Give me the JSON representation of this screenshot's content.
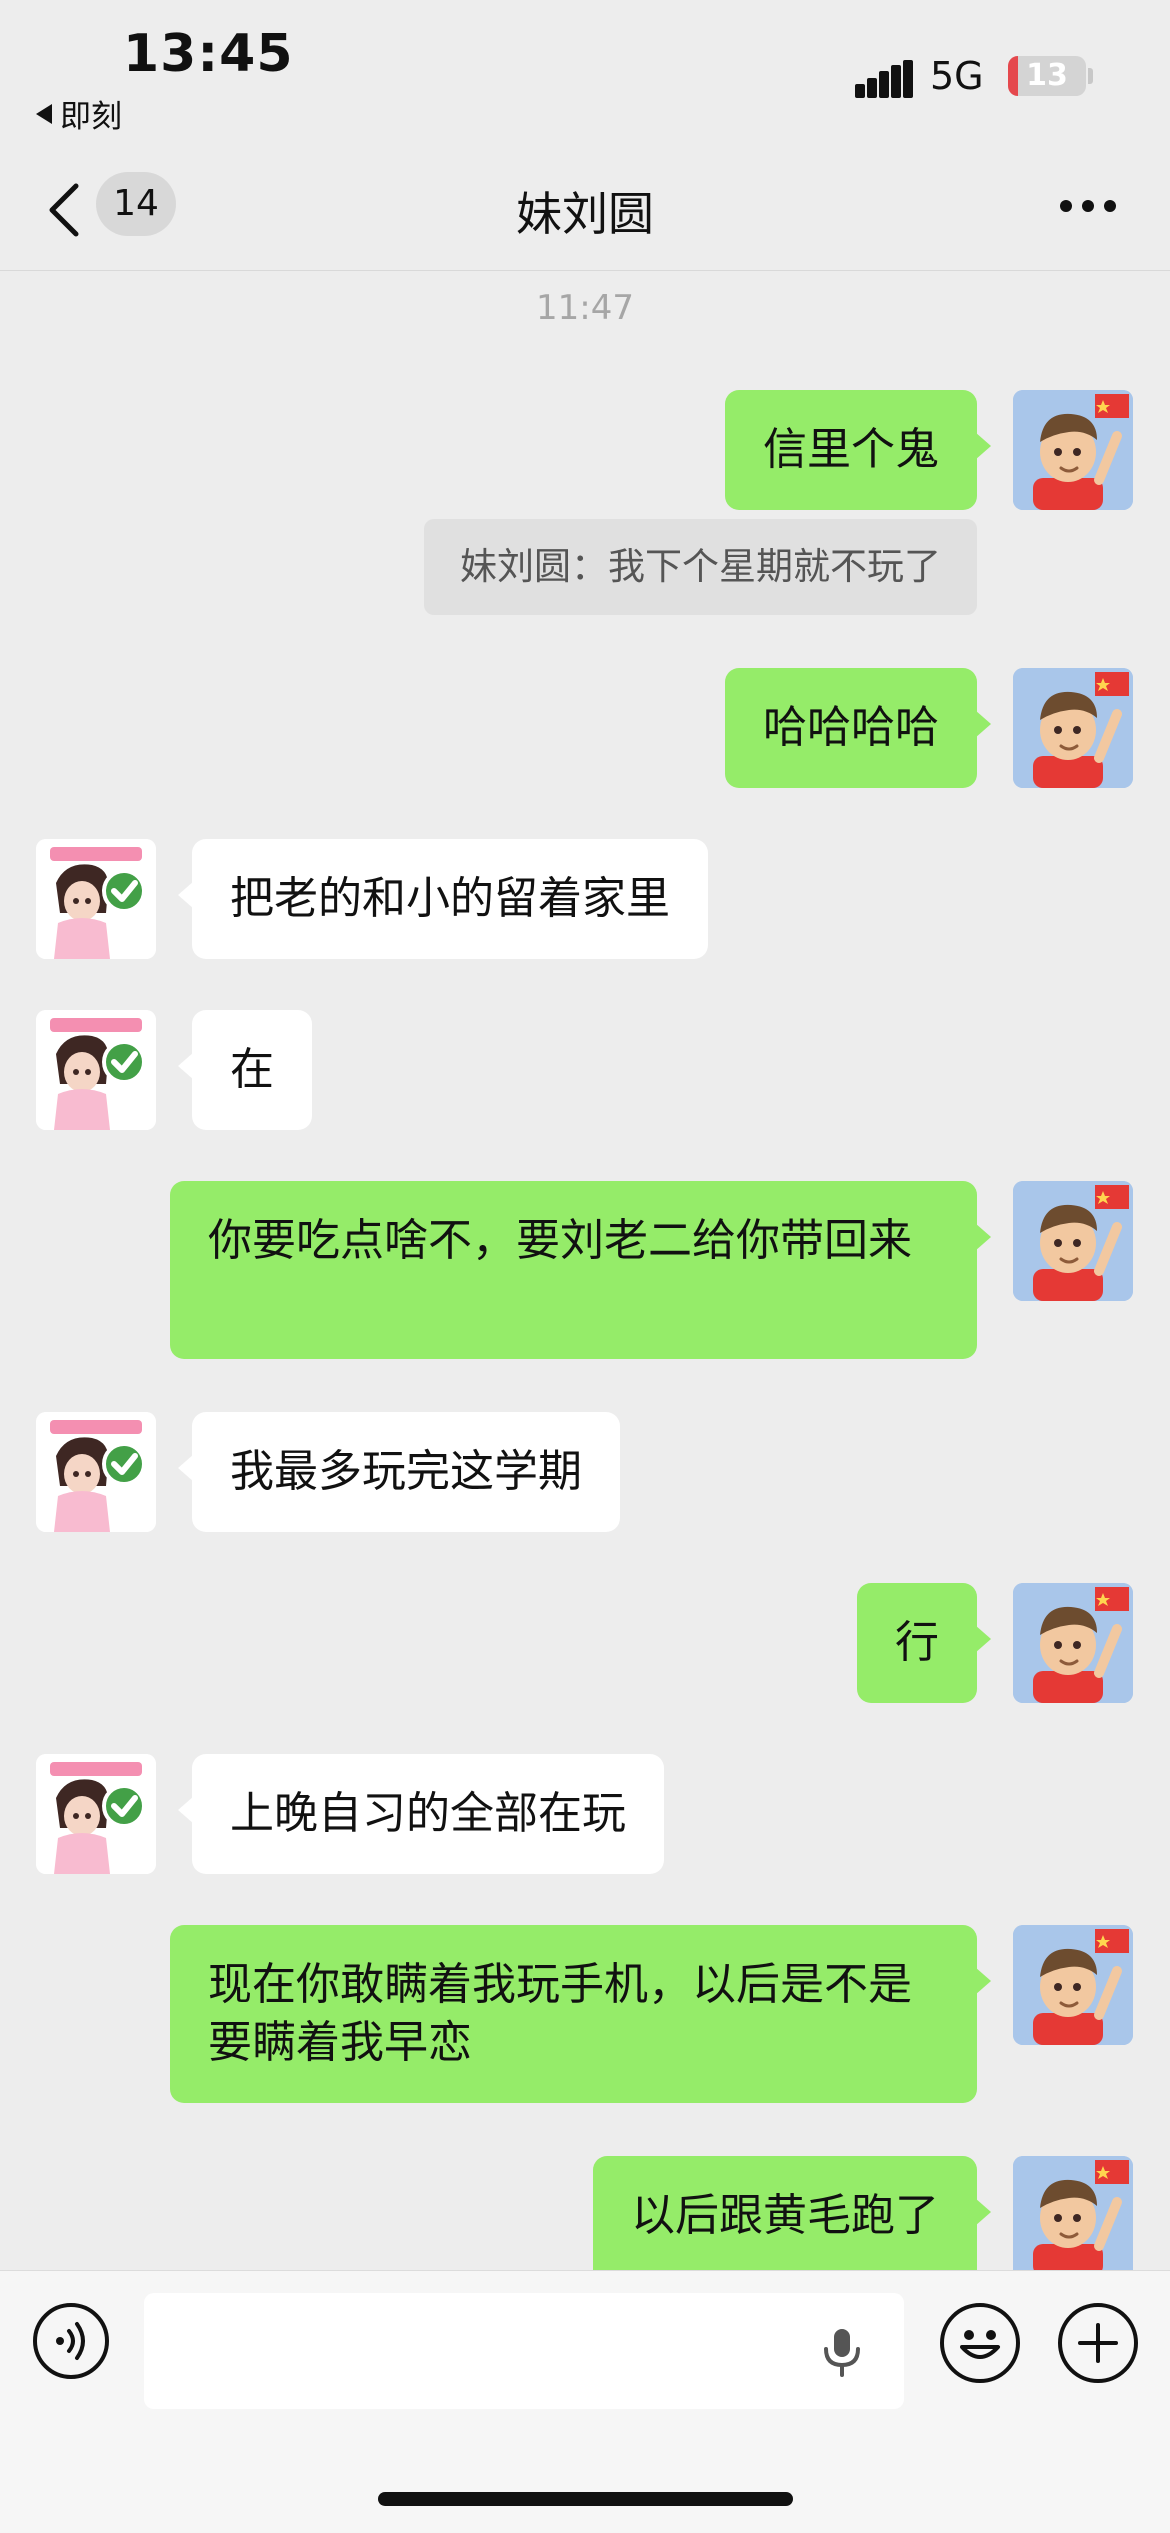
{
  "status_bar": {
    "time": "13:45",
    "back_app": "即刻",
    "network": "5G",
    "battery": 13,
    "battery_label": "13",
    "colors": {
      "battery_low": "#e5484d"
    }
  },
  "nav": {
    "unread_count": "14",
    "title": "妹刘圆",
    "back_icon": "chevron-left-icon",
    "more_icon": "more-dots-icon"
  },
  "chat": {
    "timestamp": "11:47",
    "messages": [
      {
        "from": "me",
        "text": "信里个鬼"
      },
      {
        "type": "quote",
        "text": "妹刘圆：我下个星期就不玩了"
      },
      {
        "from": "me",
        "text": "哈哈哈哈"
      },
      {
        "from": "peer",
        "text": "把老的和小的留着家里"
      },
      {
        "from": "peer",
        "text": "在"
      },
      {
        "from": "me",
        "text": "你要吃点啥不，要刘老二给你带回来"
      },
      {
        "from": "peer",
        "text": "我最多玩完这学期"
      },
      {
        "from": "me",
        "text": "行"
      },
      {
        "from": "peer",
        "text": "上晚自习的全部在玩"
      },
      {
        "from": "me",
        "text": "现在你敢瞒着我玩手机，以后是不是要瞒着我早恋"
      },
      {
        "from": "me",
        "text": "以后跟黄毛跑了"
      }
    ]
  },
  "input_bar": {
    "voice_icon": "voice-icon",
    "mic_icon": "mic-icon",
    "emoji_icon": "emoji-icon",
    "plus_icon": "plus-icon"
  },
  "colors": {
    "background": "#ededed",
    "my_bubble": "#95ec69",
    "peer_bubble": "#ffffff"
  }
}
